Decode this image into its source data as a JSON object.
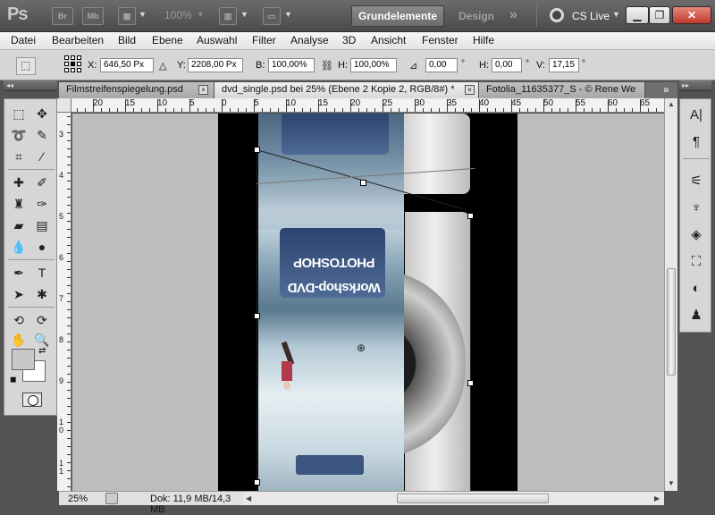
{
  "appbar": {
    "logo": "Ps",
    "bridge_label": "Br",
    "minibridge_label": "Mb",
    "zoom": "100%",
    "workspace_active": "Grundelemente",
    "workspace_other": "Design",
    "more": "»",
    "cslive": "CS Live",
    "chev": "▼"
  },
  "menu": {
    "items": [
      "Datei",
      "Bearbeiten",
      "Bild",
      "Ebene",
      "Auswahl",
      "Filter",
      "Analyse",
      "3D",
      "Ansicht",
      "Fenster",
      "Hilfe"
    ]
  },
  "options": {
    "x_label": "X:",
    "x_value": "646,50 Px",
    "y_label": "Y:",
    "y_value": "2208,00 Px",
    "b_label": "B:",
    "b_value": "100,00%",
    "h_label": "H:",
    "h_value": "100,00%",
    "angle_value": "0,00",
    "deg": "°",
    "hskew_label": "H:",
    "hskew_value": "0,00",
    "v_label": "V:",
    "v_value": "17,15"
  },
  "tabs": [
    {
      "label": "Filmstreifenspiegelung.psd"
    },
    {
      "label": "dvd_single.psd bei 25% (Ebene 2 Kopie 2, RGB/8#) *"
    },
    {
      "label": "Fotolia_11635377_S - © Rene We"
    }
  ],
  "tab_close": "×",
  "tab_more": "»",
  "ruler_top": [
    "20",
    "15",
    "10",
    "5",
    "0",
    "5",
    "10",
    "15",
    "20",
    "25",
    "30",
    "35",
    "40",
    "45",
    "50",
    "55",
    "60",
    "65"
  ],
  "ruler_left": [
    "3",
    "4",
    "5",
    "6",
    "7",
    "8",
    "9",
    "10",
    "11"
  ],
  "canvas": {
    "cover_title_1": "PHOTOSHOP",
    "cover_title_2": "Workshop-DVD"
  },
  "status": {
    "zoom": "25%",
    "doc": "Dok: 11,9 MB/14,3 MB"
  },
  "colors": {
    "foreground": "#c8c8c8",
    "background": "#ffffff"
  }
}
